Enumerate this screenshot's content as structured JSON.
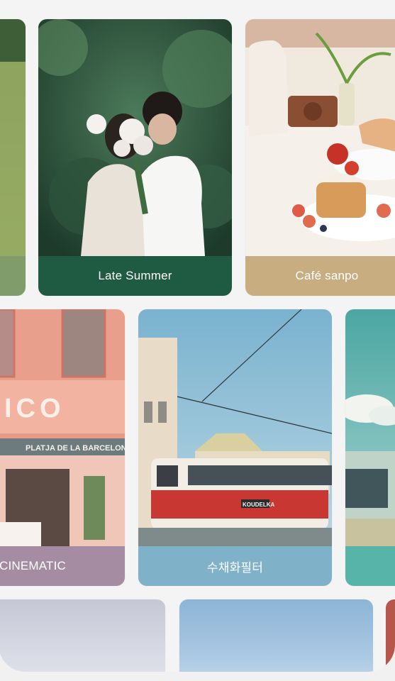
{
  "rows": [
    {
      "cards": [
        {
          "id": "green-field",
          "label": "",
          "label_color": "#7f9c6a"
        },
        {
          "id": "late-summer",
          "label": "Late Summer",
          "label_color": "#1f5a42"
        },
        {
          "id": "cafe-sanpo",
          "label": "Café sanpo",
          "label_color": "#c7ad7f"
        }
      ]
    },
    {
      "cards": [
        {
          "id": "cinematic",
          "label": "CINEMATIC",
          "label_color": "#a58ca2"
        },
        {
          "id": "watercolor",
          "label": "수채화필터",
          "label_color": "#7fb1c9"
        },
        {
          "id": "teal-sky",
          "label": "",
          "label_color": "#57b4a8"
        }
      ]
    }
  ],
  "signs": {
    "storefront": "PLATJA DE LA BARCELONE",
    "letters": "ICO",
    "tram_ad": "KOUDELKA"
  }
}
